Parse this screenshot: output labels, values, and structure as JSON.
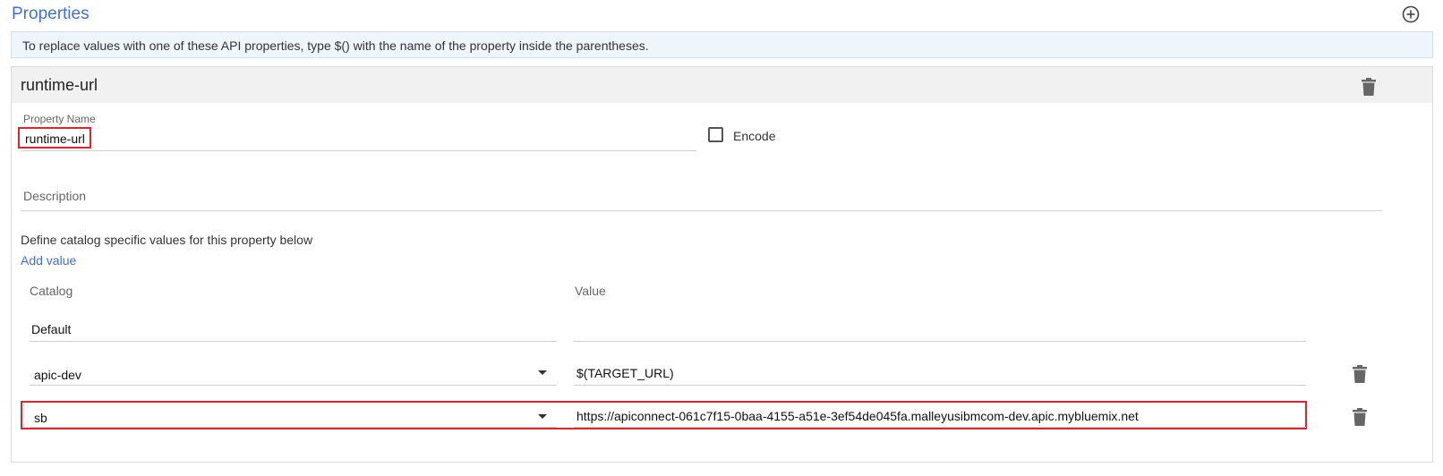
{
  "header": {
    "title": "Properties",
    "add_icon": "plus-circle-icon"
  },
  "info": {
    "text": "To replace values with one of these API properties, type $() with the name of the property inside the parentheses."
  },
  "property": {
    "title": "runtime-url",
    "name_label": "Property Name",
    "name_value": "runtime-url",
    "encode_label": "Encode",
    "encode_checked": false,
    "description_placeholder": "Description",
    "catalog_hint": "Define catalog specific values for this property below",
    "add_value_label": "Add value",
    "columns": {
      "catalog": "Catalog",
      "value": "Value"
    },
    "rows": [
      {
        "catalog": "Default",
        "value": "",
        "selectable": false,
        "deletable": false
      },
      {
        "catalog": "apic-dev",
        "value": "$(TARGET_URL)",
        "selectable": true,
        "deletable": true
      },
      {
        "catalog": "sb",
        "value": "https://apiconnect-061c7f15-0baa-4155-a51e-3ef54de045fa.malleyusibmcom-dev.apic.mybluemix.net",
        "selectable": true,
        "deletable": true
      }
    ]
  },
  "colors": {
    "accent": "#3f6fe3",
    "highlight": "#e0242b"
  }
}
